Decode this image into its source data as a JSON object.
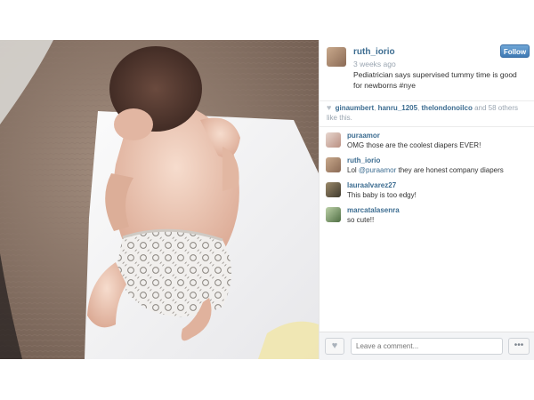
{
  "post": {
    "username": "ruth_iorio",
    "follow_label": "Follow",
    "time_ago": "3 weeks ago",
    "caption": "Pediatrician says supervised tummy time is good for newborns #nye"
  },
  "likes": {
    "likers": [
      "ginaumbert",
      "hanru_1205",
      "thelondonoilco"
    ],
    "separator1": ", ",
    "separator2": ", ",
    "suffix": " and 58 others like this."
  },
  "comments": [
    {
      "user": "puraamor",
      "text": "OMG those are the coolest diapers EVER!"
    },
    {
      "user": "ruth_iorio",
      "prefix": "Lol ",
      "mention": "@puraamor",
      "text": " they are honest company diapers"
    },
    {
      "user": "lauraalvarez27",
      "text": "This baby is too edgy!"
    },
    {
      "user": "marcatalasenra",
      "text": "so cute!!"
    }
  ],
  "footer": {
    "comment_placeholder": "Leave a comment...",
    "more_label": "•••"
  },
  "icons": {
    "like": "heart-icon",
    "more": "more-options-icon"
  },
  "colors": {
    "link": "#3d6d91",
    "follow_button": "#4a84bd",
    "muted": "#9aa5b1"
  }
}
